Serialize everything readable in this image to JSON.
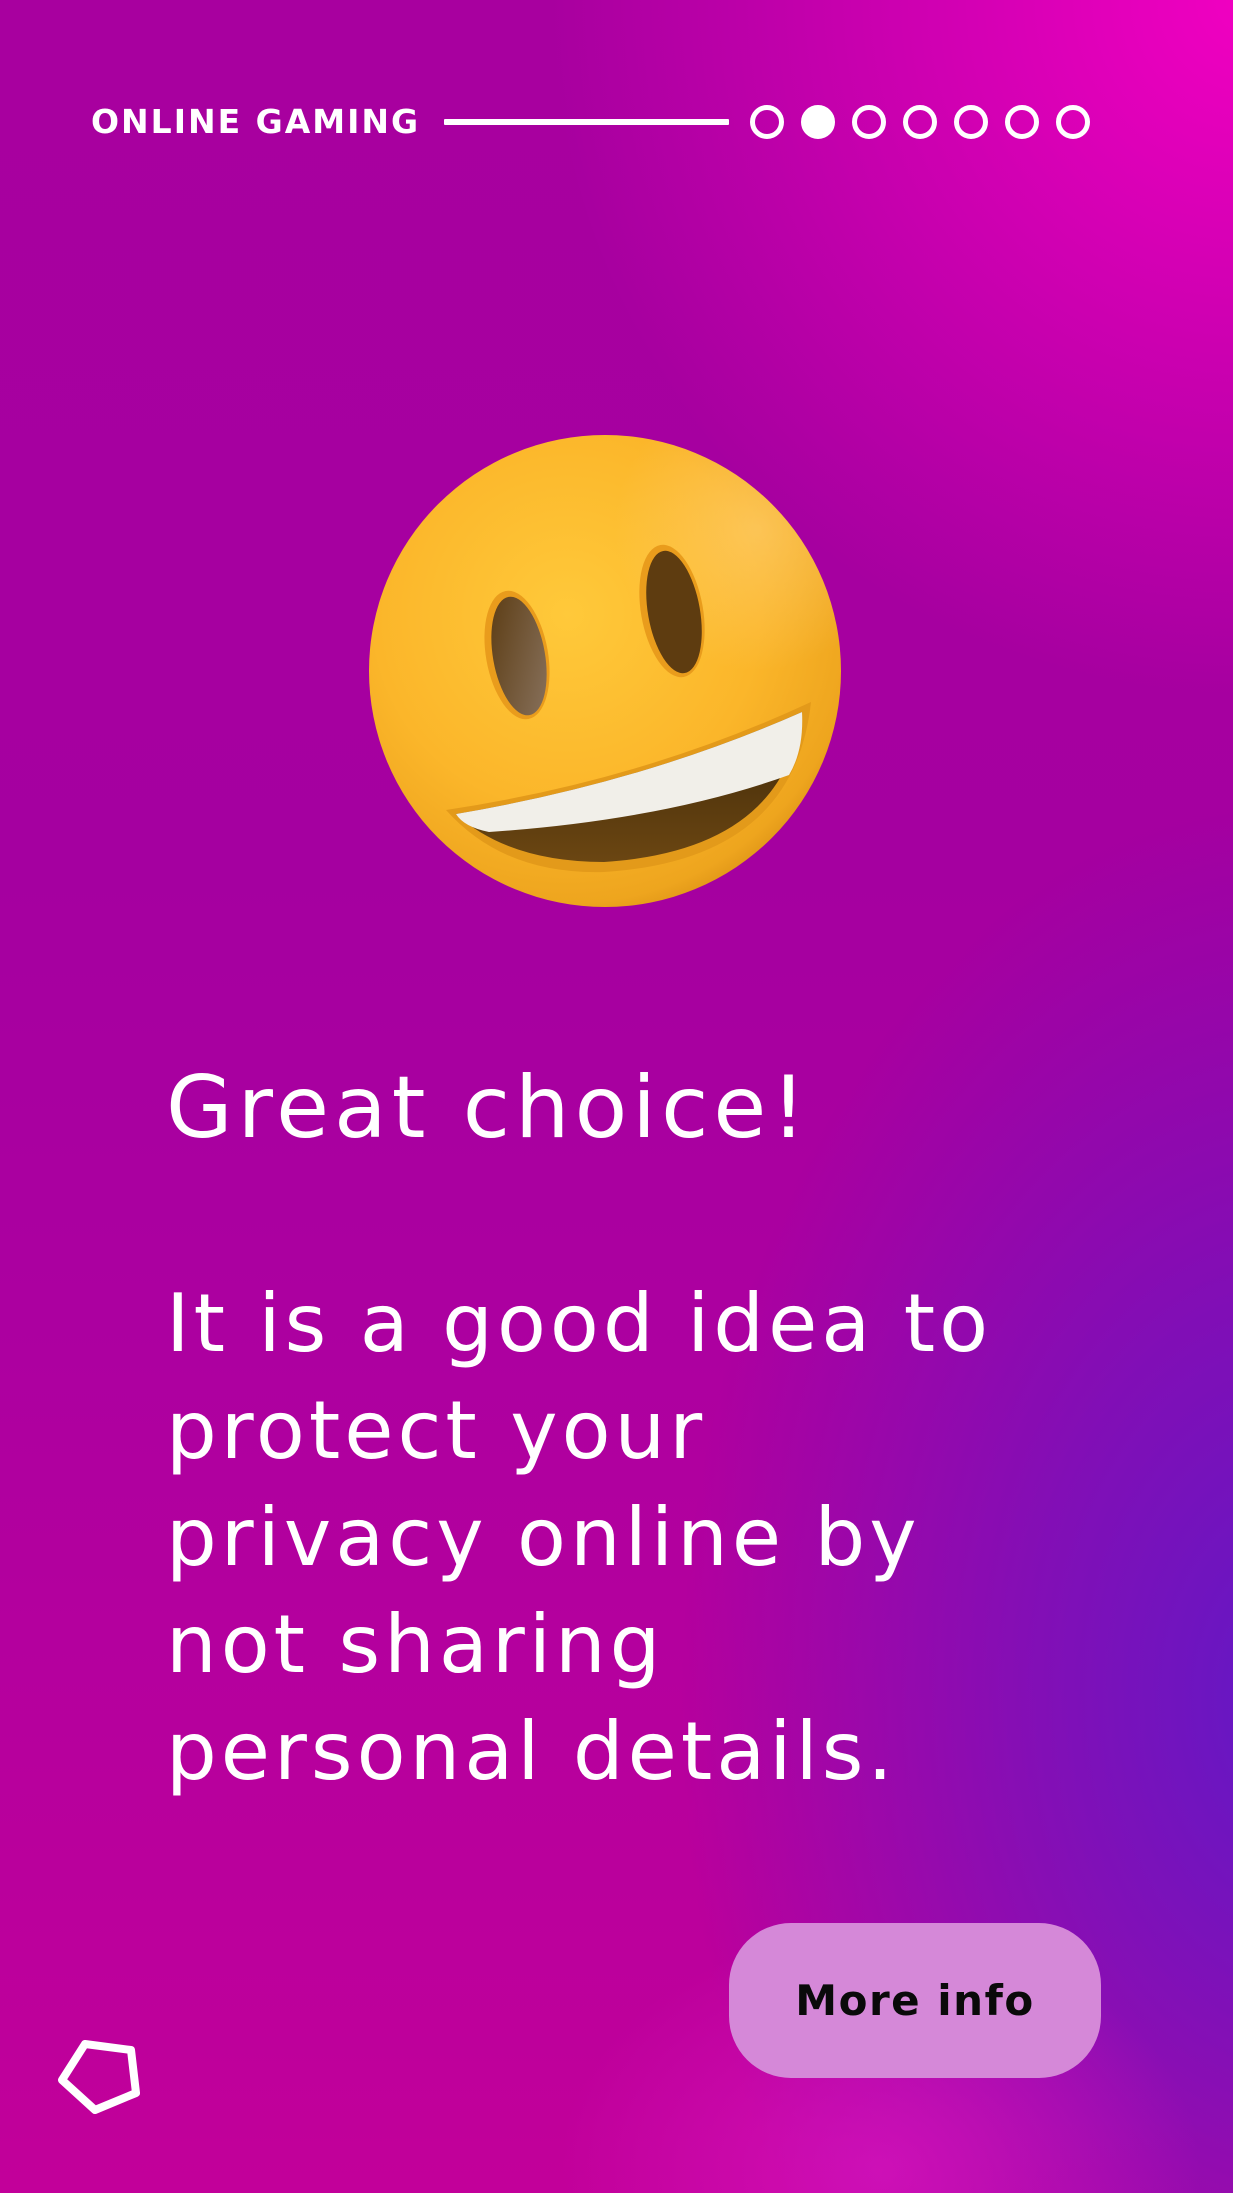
{
  "header": {
    "section_label": "ONLINE GAMING",
    "progress": {
      "total_steps": 7,
      "current_step": 2
    }
  },
  "illustration": {
    "icon": "grinning-face-emoji-icon"
  },
  "content": {
    "heading": "Great choice!",
    "body_lines": [
      "It is a good idea to",
      "protect your",
      "privacy online by",
      "not sharing",
      "personal details."
    ]
  },
  "actions": {
    "more_info_label": "More info"
  },
  "footer": {
    "logo_icon": "pentagon-logo-icon"
  },
  "colors": {
    "background_top_left": "#a8009f",
    "background_top_right": "#f000c0",
    "background_bottom_left": "#c4009a",
    "background_bottom_right": "#6418c2",
    "button_bg": "#d588d8",
    "button_text": "#0a0a0a",
    "text": "#ffffff",
    "emoji_yellow": "#fbb92c"
  }
}
